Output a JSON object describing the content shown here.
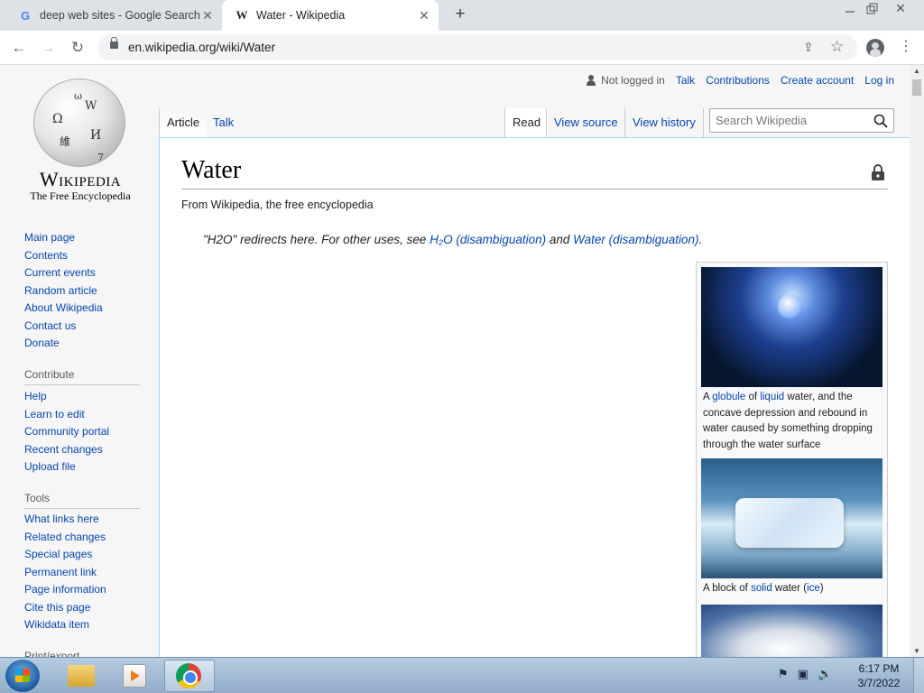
{
  "browser": {
    "tabs": [
      {
        "title": "deep web sites - Google Search",
        "favicon": "G"
      },
      {
        "title": "Water - Wikipedia",
        "favicon": "W"
      }
    ],
    "url": "en.wikipedia.org/wiki/Water"
  },
  "site": {
    "wordmark": "Wikipedia",
    "tagline": "The Free Encyclopedia"
  },
  "sidebar": {
    "nav": [
      "Main page",
      "Contents",
      "Current events",
      "Random article",
      "About Wikipedia",
      "Contact us",
      "Donate"
    ],
    "contribute_heading": "Contribute",
    "contribute": [
      "Help",
      "Learn to edit",
      "Community portal",
      "Recent changes",
      "Upload file"
    ],
    "tools_heading": "Tools",
    "tools": [
      "What links here",
      "Related changes",
      "Special pages",
      "Permanent link",
      "Page information",
      "Cite this page",
      "Wikidata item"
    ],
    "print_heading": "Print/export"
  },
  "personal": {
    "status": "Not logged in",
    "links": [
      "Talk",
      "Contributions",
      "Create account",
      "Log in"
    ]
  },
  "page_tabs": {
    "left": [
      "Article",
      "Talk"
    ],
    "right": [
      "Read",
      "View source",
      "View history"
    ]
  },
  "search": {
    "placeholder": "Search Wikipedia"
  },
  "article": {
    "title": "Water",
    "from": "From Wikipedia, the free encyclopedia",
    "hatnote": {
      "prefix": "\"H2O\" redirects here. For other uses, see ",
      "link1": "H₂O (disambiguation)",
      "middle": " and ",
      "link2": "Water (disambiguation)",
      "suffix": "."
    }
  },
  "thumbs": {
    "caption1": {
      "pre": "A ",
      "link1": "globule",
      "mid1": " of ",
      "link2": "liquid",
      "post": " water, and the concave depression and rebound in water caused by something dropping through the water surface"
    },
    "caption2": {
      "pre": "A block of ",
      "link1": "solid",
      "mid1": " water (",
      "link2": "ice",
      "post": ")"
    }
  },
  "taskbar": {
    "time": "6:17 PM",
    "date": "3/7/2022"
  }
}
